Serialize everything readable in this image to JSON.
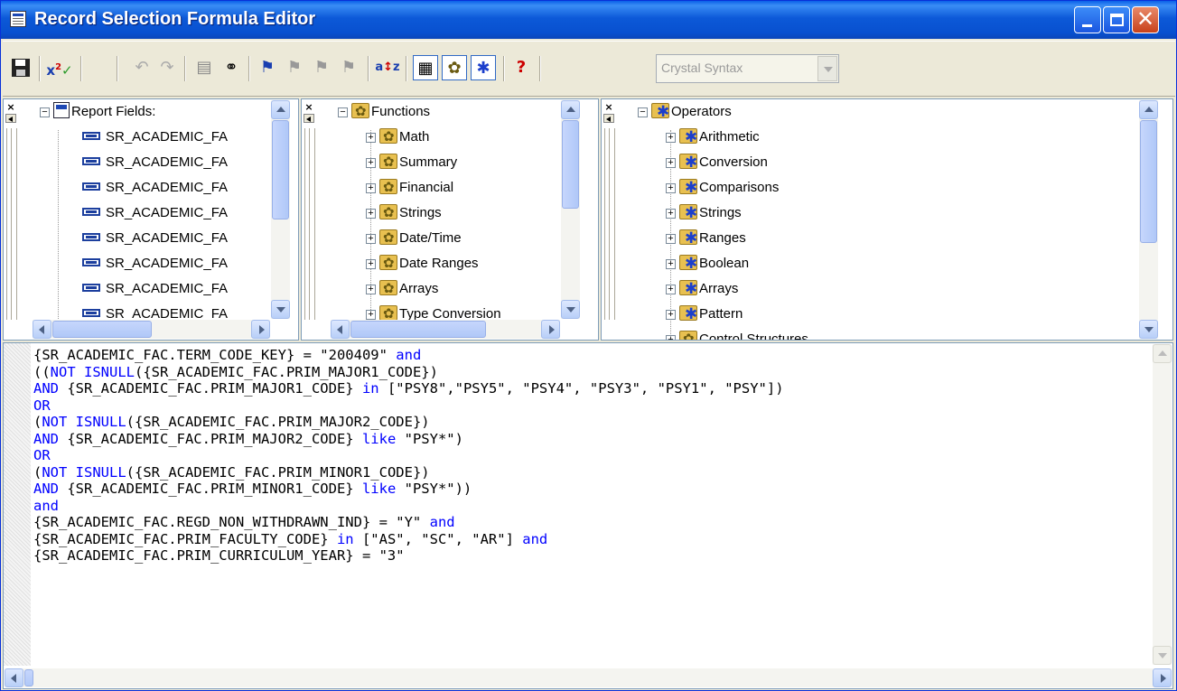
{
  "window": {
    "title": "Record Selection Formula Editor"
  },
  "toolbar": {
    "syntax_select": "Crystal Syntax"
  },
  "report_fields": {
    "root_label": "Report Fields:",
    "items": [
      "SR_ACADEMIC_FA",
      "SR_ACADEMIC_FA",
      "SR_ACADEMIC_FA",
      "SR_ACADEMIC_FA",
      "SR_ACADEMIC_FA",
      "SR_ACADEMIC_FA",
      "SR_ACADEMIC_FA",
      "SR_ACADEMIC_FA"
    ]
  },
  "functions": {
    "root_label": "Functions",
    "items": [
      "Math",
      "Summary",
      "Financial",
      "Strings",
      "Date/Time",
      "Date Ranges",
      "Arrays",
      "Type Conversion"
    ]
  },
  "operators": {
    "root_label": "Operators",
    "items": [
      "Arithmetic",
      "Conversion",
      "Comparisons",
      "Strings",
      "Ranges",
      "Boolean",
      "Arrays",
      "Pattern",
      "Control Structures"
    ]
  },
  "formula": {
    "lines": [
      [
        [
          "t",
          "{SR_ACADEMIC_FAC.TERM_CODE_KEY} = \"200409\" "
        ],
        [
          "k",
          "and"
        ]
      ],
      [
        [
          "t",
          "(("
        ],
        [
          "k",
          "NOT ISNULL"
        ],
        [
          "t",
          "({SR_ACADEMIC_FAC.PRIM_MAJOR1_CODE})"
        ]
      ],
      [
        [
          "k",
          "AND"
        ],
        [
          "t",
          " {SR_ACADEMIC_FAC.PRIM_MAJOR1_CODE} "
        ],
        [
          "k",
          "in"
        ],
        [
          "t",
          " [\"PSY8\",\"PSY5\", \"PSY4\", \"PSY3\", \"PSY1\", \"PSY\"])"
        ]
      ],
      [
        [
          "k",
          "OR"
        ]
      ],
      [
        [
          "t",
          "("
        ],
        [
          "k",
          "NOT ISNULL"
        ],
        [
          "t",
          "({SR_ACADEMIC_FAC.PRIM_MAJOR2_CODE})"
        ]
      ],
      [
        [
          "k",
          "AND"
        ],
        [
          "t",
          " {SR_ACADEMIC_FAC.PRIM_MAJOR2_CODE} "
        ],
        [
          "k",
          "like"
        ],
        [
          "t",
          " \"PSY*\")"
        ]
      ],
      [
        [
          "k",
          "OR"
        ]
      ],
      [
        [
          "t",
          "("
        ],
        [
          "k",
          "NOT ISNULL"
        ],
        [
          "t",
          "({SR_ACADEMIC_FAC.PRIM_MINOR1_CODE})"
        ]
      ],
      [
        [
          "k",
          "AND"
        ],
        [
          "t",
          " {SR_ACADEMIC_FAC.PRIM_MINOR1_CODE} "
        ],
        [
          "k",
          "like"
        ],
        [
          "t",
          " \"PSY*\"))"
        ]
      ],
      [
        [
          "k",
          "and"
        ]
      ],
      [
        [
          "t",
          "{SR_ACADEMIC_FAC.REGD_NON_WITHDRAWN_IND} = \"Y\" "
        ],
        [
          "k",
          "and"
        ]
      ],
      [
        [
          "t",
          "{SR_ACADEMIC_FAC.PRIM_FACULTY_CODE} "
        ],
        [
          "k",
          "in"
        ],
        [
          "t",
          " [\"AS\", \"SC\", \"AR\"] "
        ],
        [
          "k",
          "and"
        ]
      ],
      [
        [
          "t",
          "{SR_ACADEMIC_FAC.PRIM_CURRICULUM_YEAR} = \"3\""
        ]
      ]
    ]
  }
}
